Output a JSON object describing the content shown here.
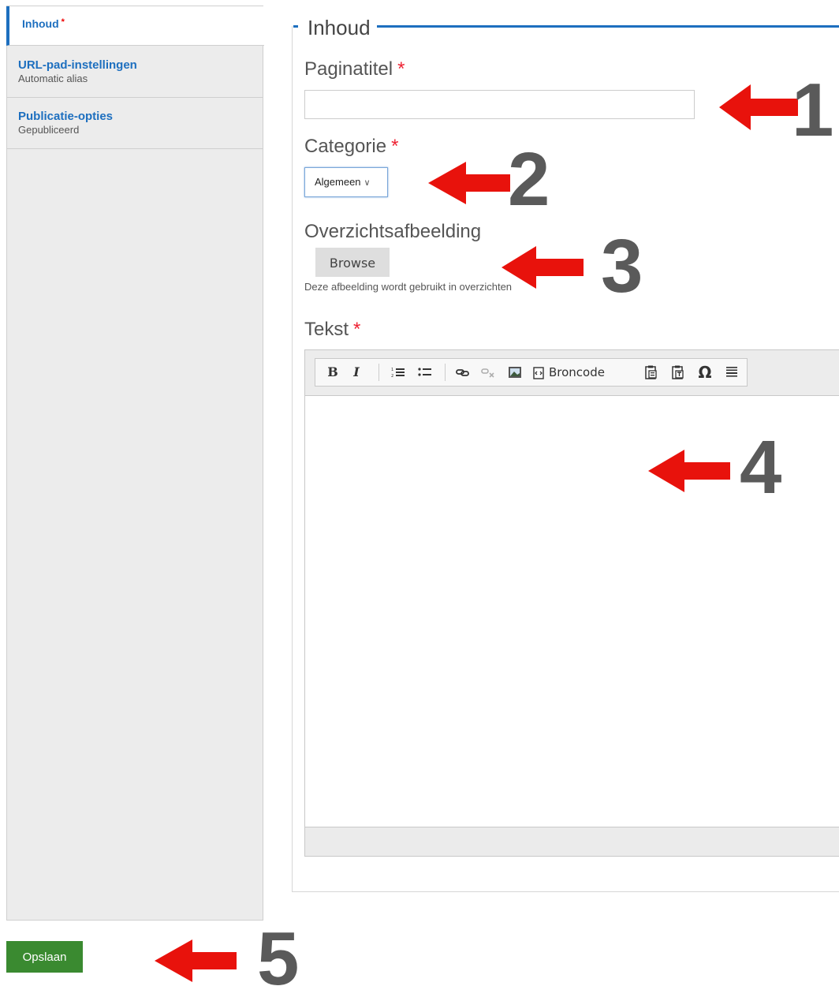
{
  "tabs": [
    {
      "label": "Inhoud",
      "summary": "",
      "required": "*"
    },
    {
      "label": "URL-pad-instellingen",
      "summary": "Automatic alias"
    },
    {
      "label": "Publicatie-opties",
      "summary": "Gepubliceerd"
    }
  ],
  "fieldset": {
    "legend": "Inhoud"
  },
  "fields": {
    "title": {
      "label": "Paginatitel",
      "required": "*",
      "value": ""
    },
    "category": {
      "label": "Categorie",
      "required": "*",
      "value": "Algemeen"
    },
    "image": {
      "label": "Overzichtsafbeelding",
      "button": "Browse",
      "description": "Deze afbeelding wordt gebruikt in overzichten"
    },
    "text": {
      "label": "Tekst",
      "required": "*"
    }
  },
  "toolbar": {
    "bold": "B",
    "italic": "I",
    "source_label": "Broncode",
    "special_char": "Ω"
  },
  "actions": {
    "save": "Opslaan"
  },
  "annotations": {
    "numbers": [
      "1",
      "2",
      "3",
      "4",
      "5"
    ],
    "arrow_color": "#e8120c",
    "number_color": "#5a5a5a"
  },
  "colors": {
    "accent": "#1d6fbf",
    "save_button": "#3a8a30",
    "required": "#e23333"
  }
}
